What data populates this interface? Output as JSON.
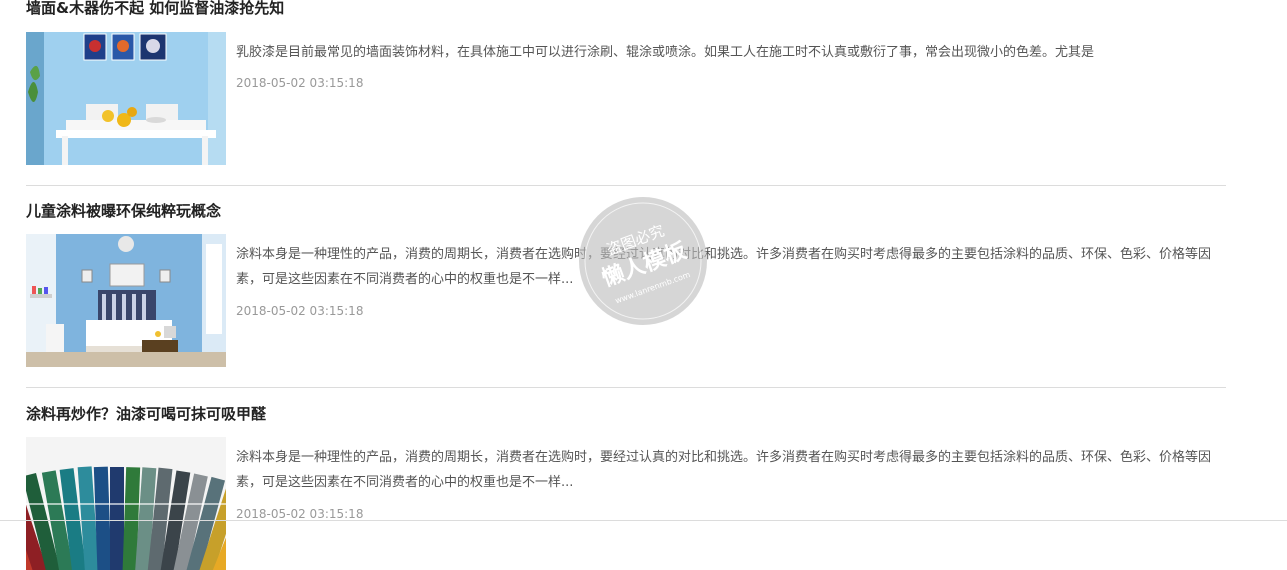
{
  "articles": [
    {
      "title": "墙面&木器伤不起 如何监督油漆抢先知",
      "summary": "乳胶漆是目前最常见的墙面装饰材料，在具体施工中可以进行涂刷、辊涂或喷涂。如果工人在施工时不认真或敷衍了事，常会出现微小的色差。尤其是",
      "date": "2018-05-02 03:15:18",
      "thumbnail_icon": "dining-room-image"
    },
    {
      "title": "儿童涂料被曝环保纯粹玩概念",
      "summary": "涂料本身是一种理性的产品，消费的周期长，消费者在选购时，要经过认真的对比和挑选。许多消费者在购买时考虑得最多的主要包括涂料的品质、环保、色彩、价格等因素，可是这些因素在不同消费者的心中的权重也是不一样...",
      "date": "2018-05-02 03:15:18",
      "thumbnail_icon": "bedroom-image"
    },
    {
      "title": "涂料再炒作？油漆可喝可抹可吸甲醛",
      "summary": "涂料本身是一种理性的产品，消费的周期长，消费者在选购时，要经过认真的对比和挑选。许多消费者在购买时考虑得最多的主要包括涂料的品质、环保、色彩、价格等因素，可是这些因素在不同消费者的心中的权重也是不一样...",
      "date": "2018-05-02 03:15:18",
      "thumbnail_icon": "color-swatch-fan-image"
    }
  ],
  "watermark": {
    "line1": "盗图必究",
    "line2": "懒人模板",
    "line3": "www.lanrenmb.com"
  },
  "colors": {
    "wall_blue": "#8cc3e6",
    "divider": "#dcdcdc",
    "date_gray": "#999999"
  }
}
